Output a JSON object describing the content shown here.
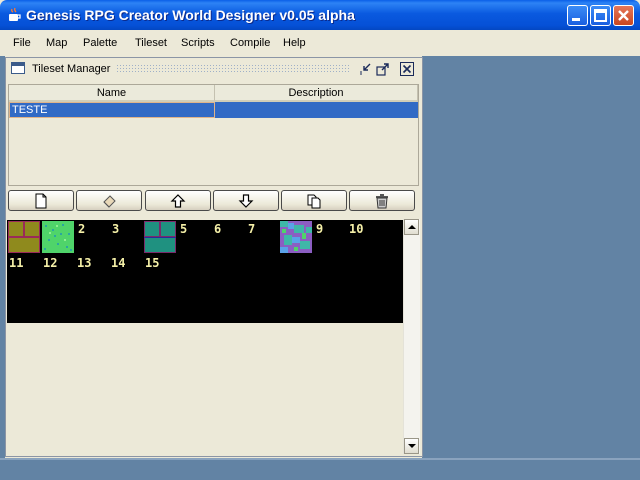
{
  "window": {
    "title": "Genesis RPG Creator World Designer v0.05 alpha",
    "title_bar_color": "#0a5ae0"
  },
  "menu": [
    "File",
    "Map",
    "Palette",
    "Tileset",
    "Scripts",
    "Compile",
    "Help"
  ],
  "panel": {
    "title": "Tileset Manager",
    "icons": [
      "tileset-window-icon",
      "minimize-panel-icon",
      "maximize-panel-icon",
      "close-panel-icon"
    ]
  },
  "table": {
    "columns": [
      "Name",
      "Description"
    ],
    "rows": [
      {
        "name": "TESTE",
        "description": "",
        "selected": true
      }
    ],
    "selection_color": "#316ac5"
  },
  "toolbar": {
    "buttons": [
      "new-file-icon",
      "eraser-icon",
      "move-up-arrow-icon",
      "move-down-arrow-icon",
      "copy-icon",
      "trash-icon"
    ]
  },
  "tiles": {
    "numbers": [
      "2",
      "3",
      "5",
      "6",
      "7",
      "9",
      "10",
      "11",
      "12",
      "13",
      "14",
      "15"
    ],
    "number_color": "#f5f0a8",
    "background": "#000000"
  },
  "desktop_color": "#6283a4"
}
